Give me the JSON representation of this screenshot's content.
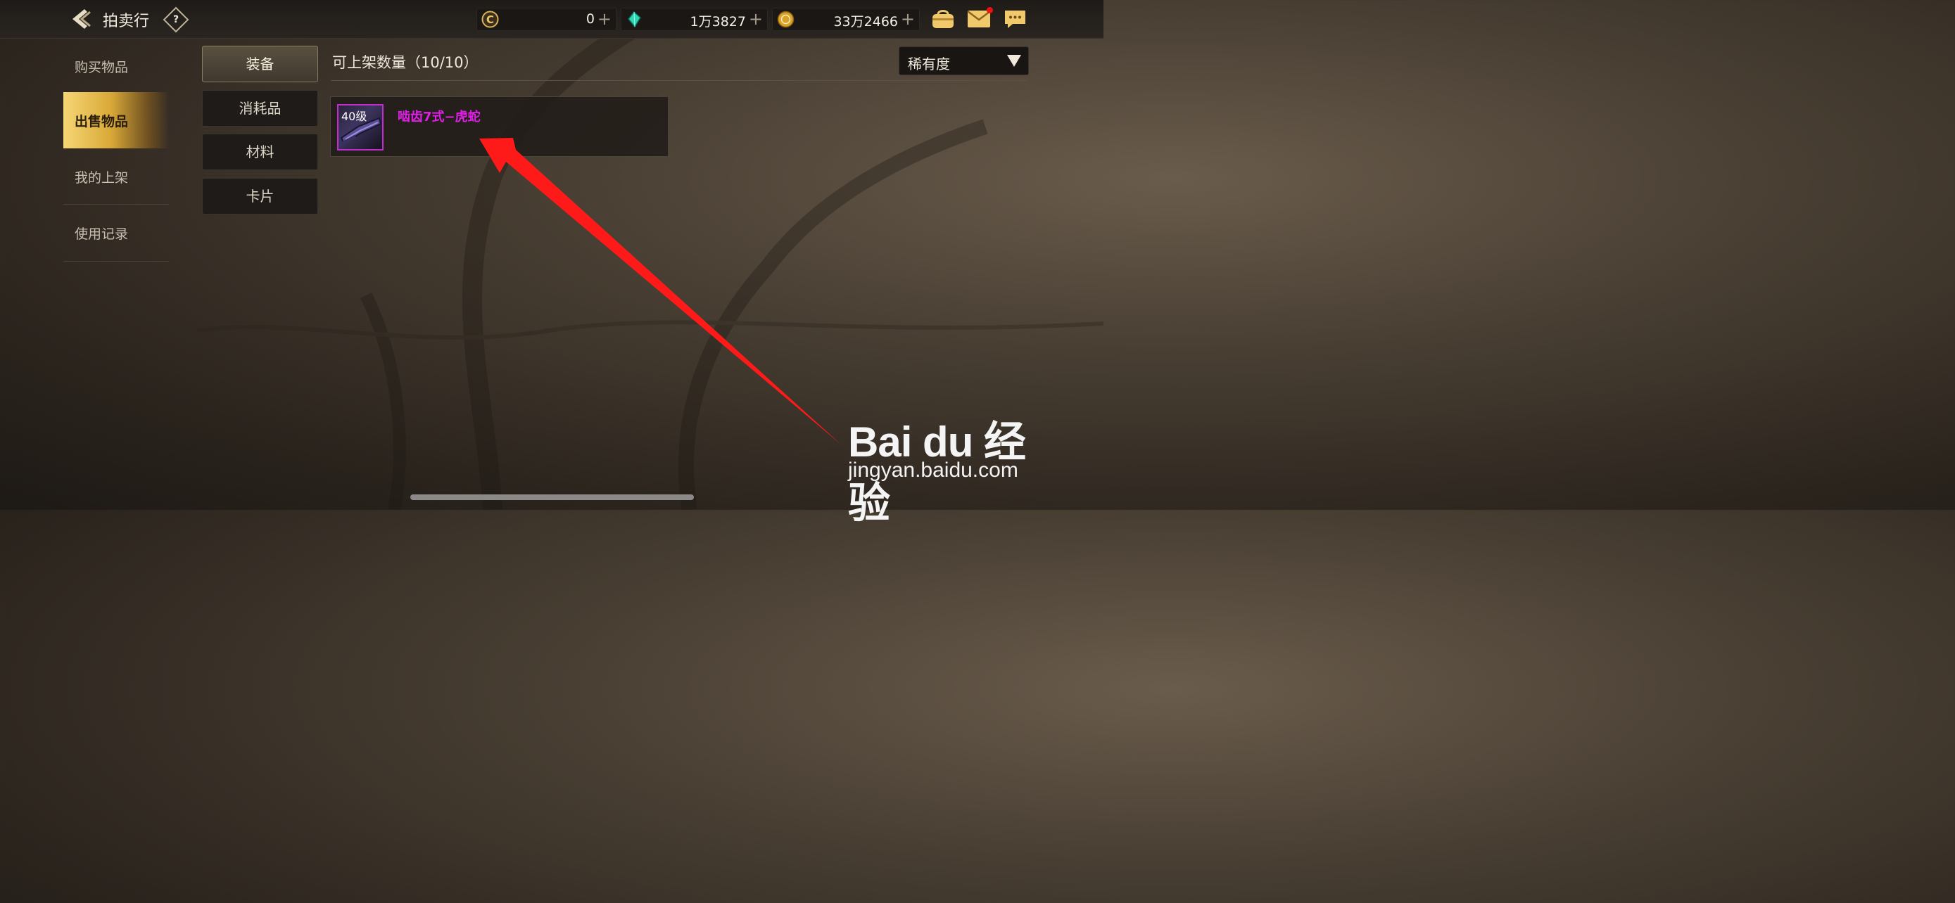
{
  "header": {
    "title": "拍卖行",
    "help_label": "?",
    "currencies": [
      {
        "icon": "c-coin-icon",
        "value": "0",
        "plus": "+"
      },
      {
        "icon": "diamond-icon",
        "value": "1万3827",
        "plus": "+"
      },
      {
        "icon": "gold-coin-icon",
        "value": "33万2466",
        "plus": "+"
      }
    ]
  },
  "sidebar": {
    "items": [
      {
        "label": "购买物品",
        "active": false
      },
      {
        "label": "出售物品",
        "active": true
      },
      {
        "label": "我的上架",
        "active": false
      },
      {
        "label": "使用记录",
        "active": false
      }
    ]
  },
  "categories": [
    {
      "label": "装备",
      "active": true
    },
    {
      "label": "消耗品",
      "active": false
    },
    {
      "label": "材料",
      "active": false
    },
    {
      "label": "卡片",
      "active": false
    }
  ],
  "main": {
    "title": "可上架数量（10/10）",
    "sort_label": "稀有度",
    "items": [
      {
        "level": "40级",
        "name": "啮齿7式−虎蛇",
        "rarity_color": "#e01fe6"
      }
    ]
  },
  "watermark": {
    "brand": "Bai du 经验",
    "url": "jingyan.baidu.com"
  },
  "colors": {
    "accent_gold": "#d9a938",
    "item_purple": "#e01fe6",
    "annotation_arrow": "#ff1a1a"
  }
}
